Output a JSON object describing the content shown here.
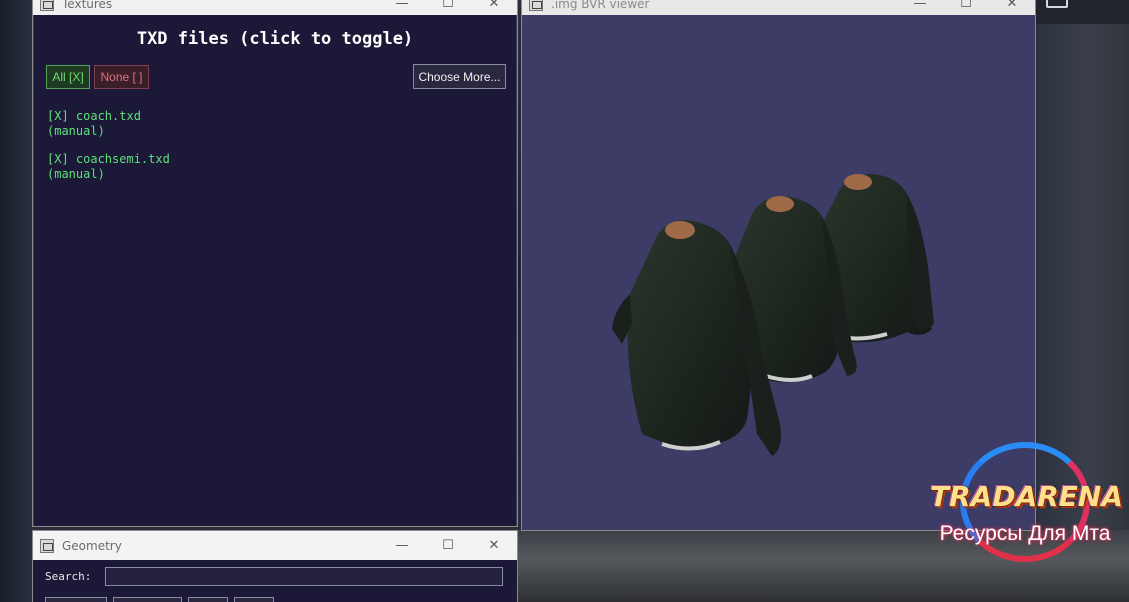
{
  "textures_window": {
    "title": "Textures",
    "heading": "TXD files (click to toggle)",
    "all_button": "All [X]",
    "none_button": "None [ ]",
    "choose_button": "Choose More...",
    "txd_files": [
      {
        "line1": "[X] coach.txd",
        "line2": "(manual)"
      },
      {
        "line1": "[X] coachsemi.txd",
        "line2": "(manual)"
      }
    ]
  },
  "viewer_window": {
    "title": ".img BVR viewer"
  },
  "geometry_window": {
    "title": "Geometry",
    "search_label": "Search:",
    "search_value": ""
  },
  "window_controls": {
    "minimize": "—",
    "maximize": "☐",
    "close": "✕"
  },
  "logo": {
    "title": "TRADARENA",
    "subtitle": "Ресурсы Для Мта"
  },
  "colors": {
    "textures_bg": "#1b1838",
    "viewer_bg": "#3c3c66",
    "txd_text": "#5fe07a",
    "jacket": "#1e2820"
  }
}
